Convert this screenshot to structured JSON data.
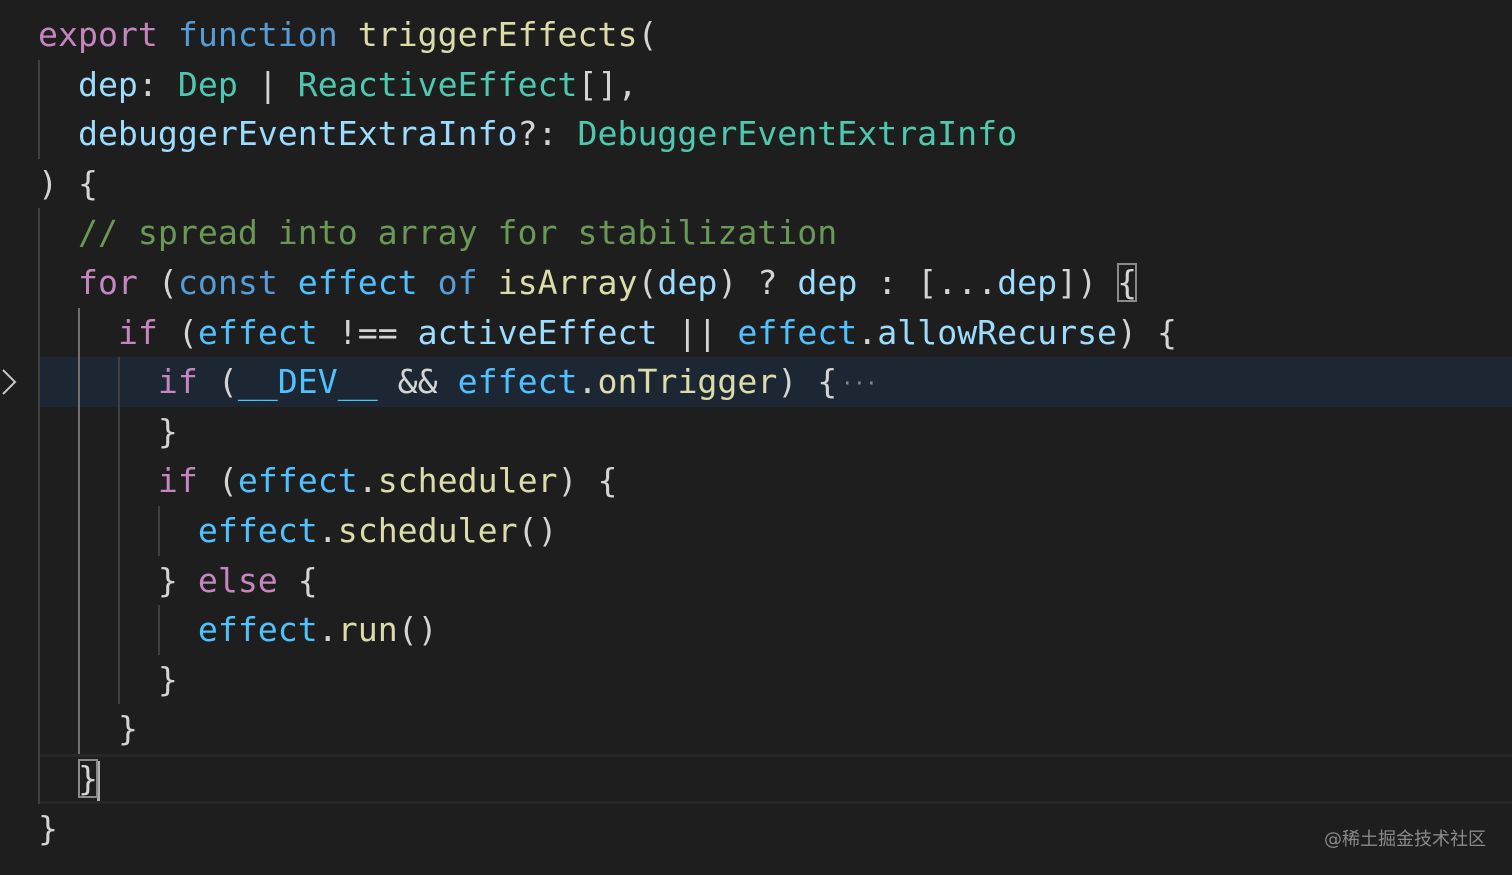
{
  "editor": {
    "lines": [
      [
        {
          "t": "export",
          "c": "kw"
        },
        {
          "t": " ",
          "c": "p"
        },
        {
          "t": "function",
          "c": "st"
        },
        {
          "t": " ",
          "c": "p"
        },
        {
          "t": "triggerEffects",
          "c": "fn"
        },
        {
          "t": "(",
          "c": "p"
        }
      ],
      [
        {
          "t": "  ",
          "c": "p"
        },
        {
          "t": "dep",
          "c": "var"
        },
        {
          "t": ": ",
          "c": "p"
        },
        {
          "t": "Dep",
          "c": "type"
        },
        {
          "t": " | ",
          "c": "p"
        },
        {
          "t": "ReactiveEffect",
          "c": "type"
        },
        {
          "t": "[],",
          "c": "p"
        }
      ],
      [
        {
          "t": "  ",
          "c": "p"
        },
        {
          "t": "debuggerEventExtraInfo",
          "c": "var"
        },
        {
          "t": "?: ",
          "c": "p"
        },
        {
          "t": "DebuggerEventExtraInfo",
          "c": "type"
        }
      ],
      [
        {
          "t": ") {",
          "c": "p"
        }
      ],
      [
        {
          "t": "  ",
          "c": "p"
        },
        {
          "t": "// spread into array for stabilization",
          "c": "cm"
        }
      ],
      [
        {
          "t": "  ",
          "c": "p"
        },
        {
          "t": "for",
          "c": "kw"
        },
        {
          "t": " (",
          "c": "p"
        },
        {
          "t": "const",
          "c": "st"
        },
        {
          "t": " ",
          "c": "p"
        },
        {
          "t": "effect",
          "c": "cvar"
        },
        {
          "t": " ",
          "c": "p"
        },
        {
          "t": "of",
          "c": "st"
        },
        {
          "t": " ",
          "c": "p"
        },
        {
          "t": "isArray",
          "c": "fn"
        },
        {
          "t": "(",
          "c": "p"
        },
        {
          "t": "dep",
          "c": "var"
        },
        {
          "t": ") ? ",
          "c": "p"
        },
        {
          "t": "dep",
          "c": "var"
        },
        {
          "t": " : [...",
          "c": "p"
        },
        {
          "t": "dep",
          "c": "var"
        },
        {
          "t": "]) ",
          "c": "p"
        },
        {
          "t": "{",
          "c": "p",
          "match": true
        }
      ],
      [
        {
          "t": "    ",
          "c": "p"
        },
        {
          "t": "if",
          "c": "kw"
        },
        {
          "t": " (",
          "c": "p"
        },
        {
          "t": "effect",
          "c": "cvar"
        },
        {
          "t": " !== ",
          "c": "p"
        },
        {
          "t": "activeEffect",
          "c": "var"
        },
        {
          "t": " || ",
          "c": "p"
        },
        {
          "t": "effect",
          "c": "cvar"
        },
        {
          "t": ".",
          "c": "p"
        },
        {
          "t": "allowRecurse",
          "c": "var"
        },
        {
          "t": ") {",
          "c": "p"
        }
      ],
      [
        {
          "t": "      ",
          "c": "p"
        },
        {
          "t": "if",
          "c": "kw"
        },
        {
          "t": " (",
          "c": "p"
        },
        {
          "t": "__DEV__",
          "c": "cvar"
        },
        {
          "t": " && ",
          "c": "p"
        },
        {
          "t": "effect",
          "c": "cvar"
        },
        {
          "t": ".",
          "c": "p"
        },
        {
          "t": "onTrigger",
          "c": "fn"
        },
        {
          "t": ") {",
          "c": "p"
        },
        {
          "t": "···",
          "c": "ellipsis"
        }
      ],
      [
        {
          "t": "      ",
          "c": "p"
        },
        {
          "t": "}",
          "c": "p"
        }
      ],
      [
        {
          "t": "      ",
          "c": "p"
        },
        {
          "t": "if",
          "c": "kw"
        },
        {
          "t": " (",
          "c": "p"
        },
        {
          "t": "effect",
          "c": "cvar"
        },
        {
          "t": ".",
          "c": "p"
        },
        {
          "t": "scheduler",
          "c": "fn"
        },
        {
          "t": ") {",
          "c": "p"
        }
      ],
      [
        {
          "t": "        ",
          "c": "p"
        },
        {
          "t": "effect",
          "c": "cvar"
        },
        {
          "t": ".",
          "c": "p"
        },
        {
          "t": "scheduler",
          "c": "fn"
        },
        {
          "t": "()",
          "c": "p"
        }
      ],
      [
        {
          "t": "      ",
          "c": "p"
        },
        {
          "t": "} ",
          "c": "p"
        },
        {
          "t": "else",
          "c": "kw"
        },
        {
          "t": " {",
          "c": "p"
        }
      ],
      [
        {
          "t": "        ",
          "c": "p"
        },
        {
          "t": "effect",
          "c": "cvar"
        },
        {
          "t": ".",
          "c": "p"
        },
        {
          "t": "run",
          "c": "fn"
        },
        {
          "t": "()",
          "c": "p"
        }
      ],
      [
        {
          "t": "      ",
          "c": "p"
        },
        {
          "t": "}",
          "c": "p"
        }
      ],
      [
        {
          "t": "    ",
          "c": "p"
        },
        {
          "t": "}",
          "c": "p"
        }
      ],
      [
        {
          "t": "  ",
          "c": "p"
        },
        {
          "t": "}",
          "c": "p",
          "match": true,
          "cursor": true
        }
      ],
      [
        {
          "t": "}",
          "c": "p"
        }
      ]
    ],
    "highlighted_line": 7,
    "current_line": 15,
    "colors": {
      "background": "#1e1e1e",
      "keyword_control": "#c586c0",
      "keyword_storage": "#569cd6",
      "function": "#dcdcaa",
      "variable": "#9cdcfe",
      "constant_variable": "#4fc1ff",
      "type": "#4ec9b0",
      "comment": "#6a9955",
      "punctuation": "#d4d4d4"
    },
    "fold_icon": "chevron-right-icon"
  },
  "watermark": {
    "text": "@稀土掘金技术社区"
  }
}
